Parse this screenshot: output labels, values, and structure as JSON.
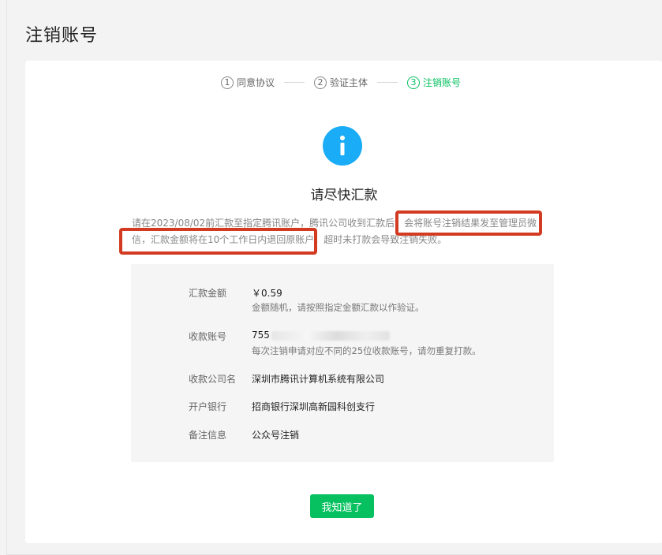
{
  "page": {
    "title": "注销账号"
  },
  "steps": [
    {
      "num": "1",
      "label": "同意协议"
    },
    {
      "num": "2",
      "label": "验证主体"
    },
    {
      "num": "3",
      "label": "注销账号"
    }
  ],
  "notice": {
    "icon": "info-icon",
    "title": "请尽快汇款",
    "desc_line1": "请在2023/08/02前汇款至指定腾讯账户，腾讯公司收到汇款后，会将账号注销结果发至管理员微",
    "desc_line2": "信，汇款金额将在10个工作日内退回原账户，超时未打款会导致注销失败。"
  },
  "details": {
    "amount": {
      "label": "汇款金额",
      "value": "￥0.59",
      "note": "金额随机，请按照指定金额汇款以作验证。"
    },
    "account": {
      "label": "收款账号",
      "value": "755",
      "note": "每次注销申请对应不同的25位收款账号，请勿重复打款。"
    },
    "company": {
      "label": "收款公司名",
      "value": "深圳市腾讯计算机系统有限公司"
    },
    "bank": {
      "label": "开户银行",
      "value": "招商银行深圳高新园科创支行"
    },
    "remark": {
      "label": "备注信息",
      "value": "公众号注销"
    }
  },
  "actions": {
    "confirm_label": "我知道了"
  },
  "colors": {
    "accent": "#07c160",
    "info": "#1aacf6",
    "highlight": "#d23b21"
  }
}
